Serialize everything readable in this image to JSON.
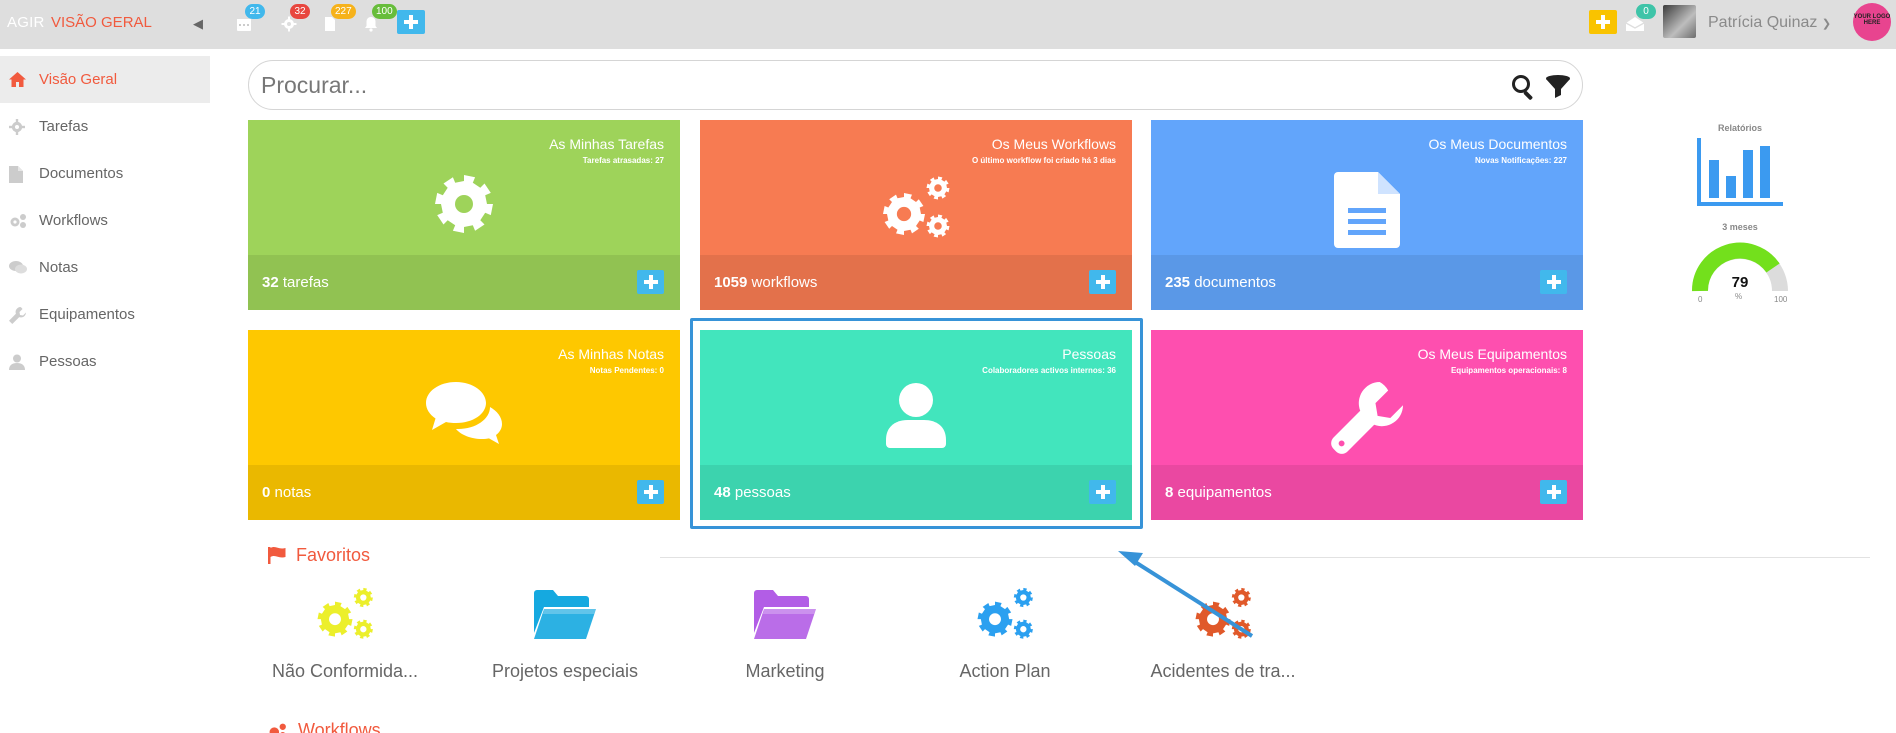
{
  "app": {
    "brand": "AGIR",
    "title": "VISÃO GERAL"
  },
  "topbar": {
    "badges": {
      "calendar": "21",
      "tasks": "32",
      "documents": "227",
      "notifications": "100",
      "messages": "0"
    },
    "user_name": "Patrícia Quinaz",
    "logo_text": "YOUR LOGO HERE"
  },
  "sidebar": {
    "items": [
      {
        "label": "Visão Geral",
        "icon": "home-icon"
      },
      {
        "label": "Tarefas",
        "icon": "gear-icon"
      },
      {
        "label": "Documentos",
        "icon": "document-icon"
      },
      {
        "label": "Workflows",
        "icon": "gears-icon"
      },
      {
        "label": "Notas",
        "icon": "comments-icon"
      },
      {
        "label": "Equipamentos",
        "icon": "wrench-icon"
      },
      {
        "label": "Pessoas",
        "icon": "user-icon"
      }
    ]
  },
  "search": {
    "placeholder": "Procurar..."
  },
  "tiles": [
    {
      "title": "As Minhas Tarefas",
      "subtitle": "Tarefas atrasadas: 27",
      "count": "32",
      "unit": "tarefas",
      "color": "#9ed35a"
    },
    {
      "title": "Os Meus Workflows",
      "subtitle": "O último workflow foi criado há 3 dias",
      "count": "1059",
      "unit": "workflows",
      "color": "#f77b52"
    },
    {
      "title": "Os Meus Documentos",
      "subtitle": "Novas Notificações: 227",
      "count": "235",
      "unit": "documentos",
      "color": "#62a5fb"
    },
    {
      "title": "As Minhas Notas",
      "subtitle": "Notas Pendentes: 0",
      "count": "0",
      "unit": "notas",
      "color": "#fec800"
    },
    {
      "title": "Pessoas",
      "subtitle": "Colaboradores activos internos: 36",
      "count": "48",
      "unit": "pessoas",
      "color": "#42e5bd"
    },
    {
      "title": "Os Meus Equipamentos",
      "subtitle": "Equipamentos operacionais: 8",
      "count": "8",
      "unit": "equipamentos",
      "color": "#fe4faf"
    }
  ],
  "reports": {
    "label": "Relatórios",
    "period": "3 meses",
    "gauge_value": "79",
    "gauge_min": "0",
    "gauge_max": "100",
    "gauge_unit": "%"
  },
  "favorites": {
    "heading": "Favoritos",
    "items": [
      {
        "label": "Não Conformida...",
        "icon": "gears-icon",
        "color": "#ecef2b"
      },
      {
        "label": "Projetos especiais",
        "icon": "folder-open-icon",
        "color": "#15a9e0"
      },
      {
        "label": "Marketing",
        "icon": "folder-open-icon",
        "color": "#b25de6"
      },
      {
        "label": "Action Plan",
        "icon": "gears-icon",
        "color": "#2ba0f0"
      },
      {
        "label": "Acidentes de tra...",
        "icon": "gears-icon",
        "color": "#e0592a"
      }
    ]
  },
  "workflows_section": {
    "heading": "Workflows"
  }
}
